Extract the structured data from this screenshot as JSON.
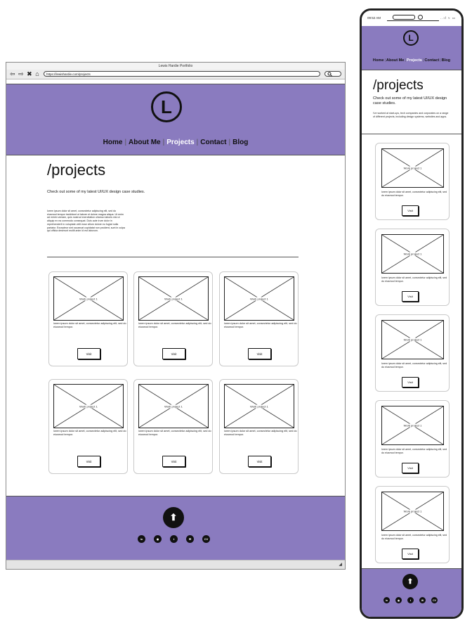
{
  "browser": {
    "window_title": "Lewis Hardie Portfolio",
    "url": "https://lewishardie.com/projects",
    "nav_symbols": [
      "⇦",
      "⇨",
      "✖",
      "⌂"
    ],
    "search_symbol": "🔍"
  },
  "site": {
    "logo_letter": "L",
    "nav": [
      {
        "label": "Home",
        "active": false
      },
      {
        "label": "About Me",
        "active": false
      },
      {
        "label": "Projects",
        "active": true
      },
      {
        "label": "Contact",
        "active": false
      },
      {
        "label": "Blog",
        "active": false
      }
    ],
    "page_title": "/projects",
    "subtitle": "Check out some of my latest UI/UX design case studies.",
    "desktop_paragraph": "lorem ipsum dolor sit amet, consectetur adipiscing elit, sed do eiusmod tempor incididunt ut labore et dolore magna aliqua. Ut enim ad minim veniam, quis nostrud exercitation ullamco laboris nisi ut aliquip ex ea commodo consequat. Duis aute irure dolor in reprehenderit in voluptate velit esse cillum dolore eu fugiat nulla pariatur. Excepteur sint occaecat cupidatat non proident, sunt in culpa qui officia deserunt mollit anim id est laborum.",
    "mobile_subtitle": "Check out some of my latest UI/UX design case studies.",
    "mobile_paragraph": "I've worked at start-ups, tech companies and corporates on a range of different projects, including design systems, websites and apps.",
    "card_placeholder": "Work project 1",
    "card_description": "lorem ipsum dolor sit amet, consectetur adipiscing elit, sed do eiusmod tempor.",
    "card_button": "Visit",
    "up_icon": "⬆",
    "social": [
      {
        "name": "linkedin-icon",
        "glyph": "in"
      },
      {
        "name": "github-icon",
        "glyph": "◉"
      },
      {
        "name": "twitter-icon",
        "glyph": "t"
      },
      {
        "name": "email-icon",
        "glyph": "✉"
      },
      {
        "name": "cv-icon",
        "glyph": "CV"
      }
    ]
  },
  "phone": {
    "time": "09:52 AM",
    "status_icons": "..ıl ≈ ▭"
  },
  "colors": {
    "brand_purple": "#8a7bbf",
    "active_nav": "#ffffff",
    "dark": "#111111"
  }
}
